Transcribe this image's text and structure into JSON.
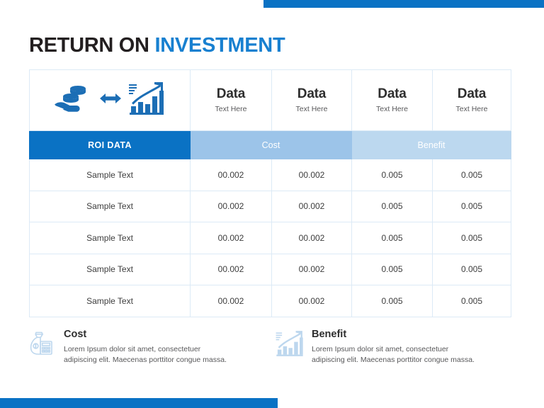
{
  "theme": {
    "brand_blue": "#0A72C4",
    "title_blue": "#1880D0",
    "cost_band": "#9CC4E9",
    "benefit_band": "#BCD8EF",
    "border": "#DCEAF6",
    "icon_light": "#BDD7EE"
  },
  "title": {
    "part_dark": "RETURN ON",
    "part_blue": "INVESTMENT"
  },
  "table": {
    "icon_cell": {
      "coins_hand_icon": "hand-holding-coins-icon",
      "arrows_icon": "double-arrow-icon",
      "growth_icon": "bar-chart-growth-icon"
    },
    "column_headers": [
      {
        "data": "Data",
        "sub": "Text Here"
      },
      {
        "data": "Data",
        "sub": "Text Here"
      },
      {
        "data": "Data",
        "sub": "Text Here"
      },
      {
        "data": "Data",
        "sub": "Text Here"
      }
    ],
    "bands": {
      "label": "ROI DATA",
      "cost": "Cost",
      "benefit": "Benefit"
    },
    "rows": [
      {
        "label": "Sample Text",
        "c1": "00.002",
        "c2": "00.002",
        "c3": "0.005",
        "c4": "0.005",
        "c4_muted": true
      },
      {
        "label": "Sample Text",
        "c1": "00.002",
        "c2": "00.002",
        "c3": "0.005",
        "c4": "0.005",
        "c4_muted": false
      },
      {
        "label": "Sample Text",
        "c1": "00.002",
        "c2": "00.002",
        "c3": "0.005",
        "c4": "0.005",
        "c4_muted": false
      },
      {
        "label": "Sample Text",
        "c1": "00.002",
        "c2": "00.002",
        "c3": "0.005",
        "c4": "0.005",
        "c4_muted": false
      },
      {
        "label": "Sample Text",
        "c1": "00.002",
        "c2": "00.002",
        "c3": "0.005",
        "c4": "0.005",
        "c4_muted": false
      }
    ]
  },
  "features": {
    "cost": {
      "icon": "money-bag-calculator-icon",
      "heading": "Cost",
      "body": "Lorem Ipsum dolor sit amet, consectetuer adipiscing elit. Maecenas porttitor congue massa."
    },
    "benefit": {
      "icon": "bar-chart-growth-icon",
      "heading": "Benefit",
      "body": "Lorem Ipsum dolor sit amet, consectetuer adipiscing elit. Maecenas porttitor congue massa."
    }
  }
}
